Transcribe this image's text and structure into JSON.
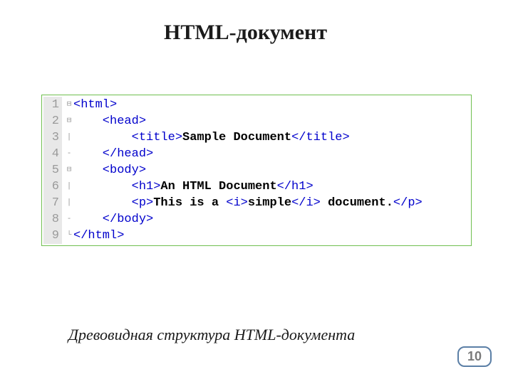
{
  "title": "HTML-документ",
  "caption": "Древовидная структура HTML-документа",
  "page_number": "10",
  "code": {
    "lines": [
      {
        "n": "1",
        "fold": "⊟",
        "segs": [
          {
            "cls": "tag",
            "t": "<html>"
          }
        ]
      },
      {
        "n": "2",
        "fold": "⊟",
        "segs": [
          {
            "cls": "tag",
            "t": "    <head>"
          }
        ]
      },
      {
        "n": "3",
        "fold": "|",
        "segs": [
          {
            "cls": "tag",
            "t": "        <title>"
          },
          {
            "cls": "txt",
            "t": "Sample Document"
          },
          {
            "cls": "tag",
            "t": "</title>"
          }
        ]
      },
      {
        "n": "4",
        "fold": "-",
        "segs": [
          {
            "cls": "tag",
            "t": "    </head>"
          }
        ]
      },
      {
        "n": "5",
        "fold": "⊟",
        "segs": [
          {
            "cls": "tag",
            "t": "    <body>"
          }
        ]
      },
      {
        "n": "6",
        "fold": "|",
        "segs": [
          {
            "cls": "tag",
            "t": "        <h1>"
          },
          {
            "cls": "txt",
            "t": "An HTML Document"
          },
          {
            "cls": "tag",
            "t": "</h1>"
          }
        ]
      },
      {
        "n": "7",
        "fold": "|",
        "segs": [
          {
            "cls": "tag",
            "t": "        <p>"
          },
          {
            "cls": "txt",
            "t": "This is a "
          },
          {
            "cls": "tag",
            "t": "<i>"
          },
          {
            "cls": "txt",
            "t": "simple"
          },
          {
            "cls": "tag",
            "t": "</i>"
          },
          {
            "cls": "txt",
            "t": " document."
          },
          {
            "cls": "tag",
            "t": "</p>"
          }
        ]
      },
      {
        "n": "8",
        "fold": "-",
        "segs": [
          {
            "cls": "tag",
            "t": "    </body>"
          }
        ]
      },
      {
        "n": "9",
        "fold": "└",
        "segs": [
          {
            "cls": "tag",
            "t": "</html>"
          }
        ]
      }
    ]
  }
}
